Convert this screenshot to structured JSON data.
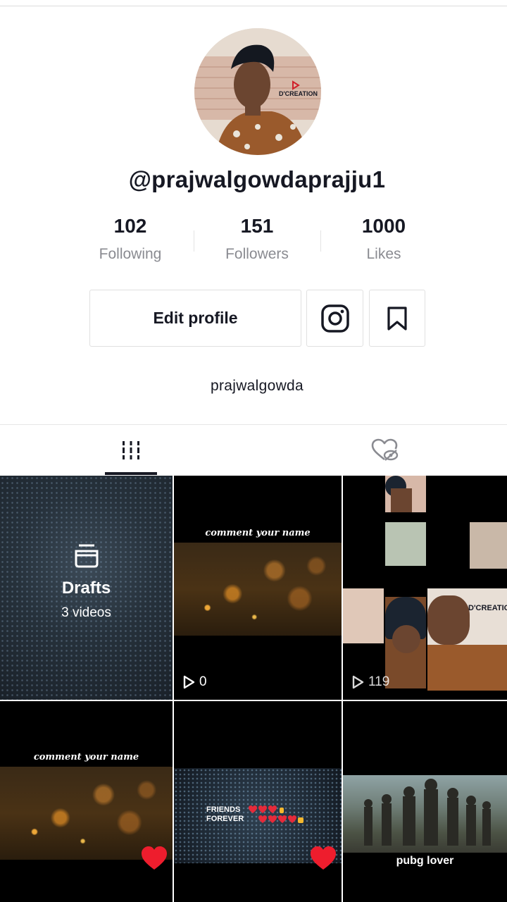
{
  "profile": {
    "username": "@prajwalgowdaprajju1",
    "bio": "prajwalgowda",
    "avatar_watermark": "D'CREATION"
  },
  "stats": [
    {
      "value": "102",
      "label": "Following"
    },
    {
      "value": "151",
      "label": "Followers"
    },
    {
      "value": "1000",
      "label": "Likes"
    }
  ],
  "actions": {
    "edit_profile": "Edit profile",
    "instagram_icon": "instagram-icon",
    "bookmark_icon": "bookmark-icon"
  },
  "tabs": [
    {
      "icon": "grid-icon",
      "active": true
    },
    {
      "icon": "liked-hidden-icon",
      "active": false
    }
  ],
  "videos": {
    "drafts": {
      "title": "Drafts",
      "count": "3 videos"
    },
    "items": [
      {
        "caption": "comment your name",
        "plays": "0"
      },
      {
        "watermark": "D'CREATION",
        "plays": "119"
      },
      {
        "caption": "comment your name"
      },
      {
        "caption_line1": "FRIENDS",
        "caption_line2": "FOREVER"
      },
      {
        "caption": "pubg lover"
      }
    ]
  },
  "colors": {
    "text": "#161823",
    "muted": "#8a8b91",
    "border": "#e0e0e0",
    "heart": "#ee1d2d"
  }
}
